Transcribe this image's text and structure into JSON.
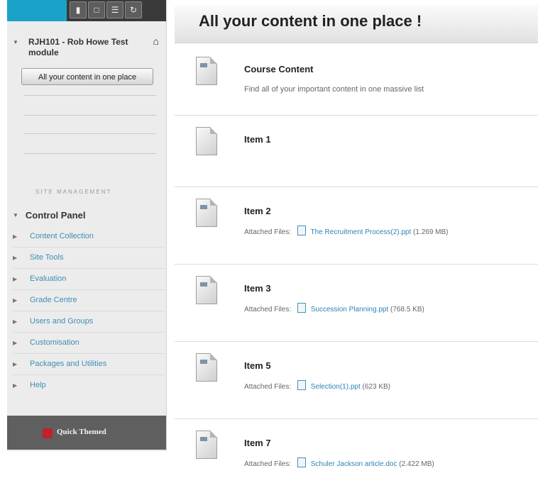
{
  "sidebar": {
    "course_title": "RJH101 - Rob Howe Test module",
    "current_page_button": "All your content in one place",
    "site_management_label": "SITE MANAGEMENT",
    "control_panel_label": "Control Panel",
    "menu": [
      {
        "label": "Content Collection"
      },
      {
        "label": "Site Tools"
      },
      {
        "label": "Evaluation"
      },
      {
        "label": "Grade Centre"
      },
      {
        "label": "Users and Groups"
      },
      {
        "label": "Customisation"
      },
      {
        "label": "Packages and Utilities"
      },
      {
        "label": "Help"
      }
    ],
    "footer_brand": "Quick Themed"
  },
  "main": {
    "title": "All your content in one place !",
    "items": [
      {
        "title": "Course Content",
        "description": "Find all of your important content in one massive list"
      },
      {
        "title": "Item 1"
      },
      {
        "title": "Item 2",
        "attached_label": "Attached Files:",
        "file_name": "The Recruitment Process(2).ppt",
        "file_size": "(1.269 MB)"
      },
      {
        "title": "Item 3",
        "attached_label": "Attached Files:",
        "file_name": "Succession Planning.ppt",
        "file_size": "(768.5 KB)"
      },
      {
        "title": "Item 5",
        "attached_label": "Attached Files:",
        "file_name": "Selection(1).ppt",
        "file_size": "(623 KB)"
      },
      {
        "title": "Item 7",
        "attached_label": "Attached Files:",
        "file_name": "Schuler Jackson article.doc",
        "file_size": "(2.422 MB)"
      }
    ]
  },
  "colors": {
    "accent": "#19a3c9",
    "link": "#2f83b5",
    "footer": "#5f5f5f",
    "logo": "#c0212a"
  }
}
